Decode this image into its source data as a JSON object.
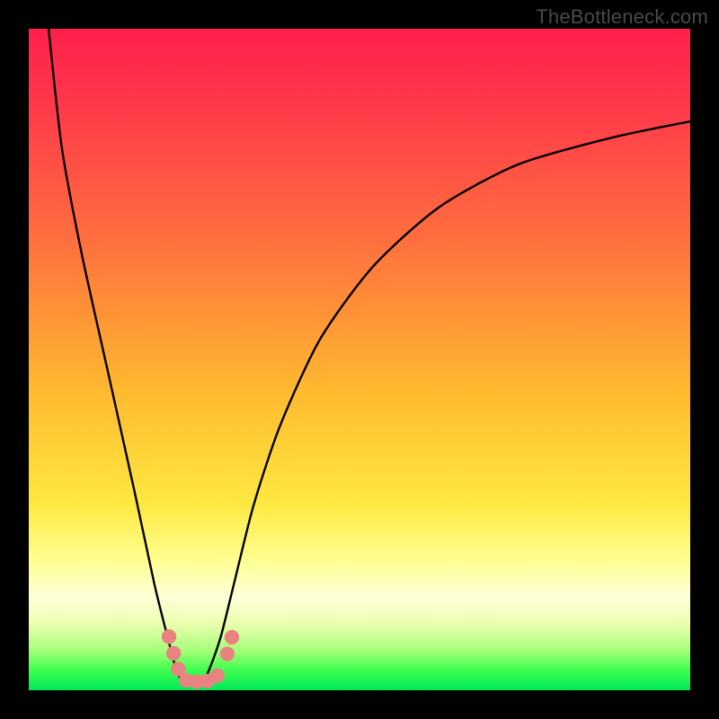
{
  "watermark": "TheBottleneck.com",
  "chart_data": {
    "type": "line",
    "title": "",
    "xlabel": "",
    "ylabel": "",
    "xlim": [
      0,
      100
    ],
    "ylim": [
      0,
      100
    ],
    "series": [
      {
        "name": "bottleneck-curve",
        "x": [
          3,
          5,
          8,
          12,
          16,
          19,
          21,
          22.5,
          24,
          25.5,
          27,
          29,
          31,
          34,
          38,
          44,
          52,
          62,
          74,
          88,
          100
        ],
        "y": [
          100,
          82,
          66,
          48,
          30,
          16,
          8,
          2.5,
          1,
          1,
          2.5,
          8,
          16,
          28,
          40,
          53,
          64,
          73,
          79.5,
          83.5,
          86
        ]
      }
    ],
    "markers": [
      {
        "name": "marker",
        "x": 21.2,
        "y": 8.1
      },
      {
        "name": "marker",
        "x": 21.9,
        "y": 5.6
      },
      {
        "name": "marker",
        "x": 22.6,
        "y": 3.2
      },
      {
        "name": "marker",
        "x": 23.8,
        "y": 1.5
      },
      {
        "name": "marker",
        "x": 25.4,
        "y": 1.3
      },
      {
        "name": "marker",
        "x": 27.0,
        "y": 1.4
      },
      {
        "name": "marker",
        "x": 28.5,
        "y": 2.2
      },
      {
        "name": "marker",
        "x": 30.0,
        "y": 5.5
      },
      {
        "name": "marker",
        "x": 30.7,
        "y": 8.0
      }
    ],
    "colors": {
      "curve": "#000000",
      "markers": "#e98381",
      "gradient_top": "#ff1f4b",
      "gradient_bottom": "#00e85a"
    }
  }
}
